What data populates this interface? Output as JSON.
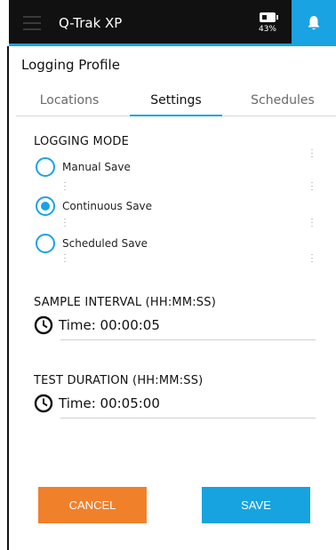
{
  "header": {
    "app_title": "Q-Trak XP",
    "battery_percent": "43%",
    "battery_level": 0.43,
    "accent_color": "#1aa3e2"
  },
  "page": {
    "title": "Logging Profile"
  },
  "tabs": [
    {
      "label": "Locations",
      "active": false
    },
    {
      "label": "Settings",
      "active": true
    },
    {
      "label": "Schedules",
      "active": false
    }
  ],
  "logging_mode": {
    "label": "LOGGING MODE",
    "options": [
      {
        "label": "Manual Save",
        "selected": false
      },
      {
        "label": "Continuous Save",
        "selected": true
      },
      {
        "label": "Scheduled Save",
        "selected": false
      }
    ]
  },
  "sample_interval": {
    "label": "SAMPLE INTERVAL (HH:MM:SS)",
    "value": "Time: 00:00:05",
    "icon": "clock-icon"
  },
  "test_duration": {
    "label": "TEST DURATION (HH:MM:SS)",
    "value": "Time: 00:05:00",
    "icon": "clock-icon"
  },
  "buttons": {
    "cancel_label": "CANCEL",
    "save_label": "SAVE",
    "cancel_color": "#f1802b",
    "save_color": "#17a3e0"
  }
}
